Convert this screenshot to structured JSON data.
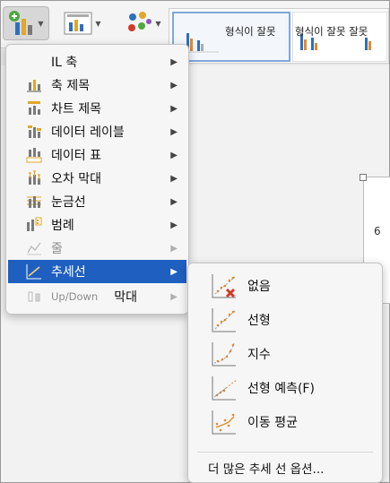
{
  "ribbon": {
    "buttons": [
      {
        "name": "add-chart-element-button",
        "icon": "add-chart-element-icon"
      },
      {
        "name": "quick-layout-button",
        "icon": "quick-layout-icon"
      },
      {
        "name": "change-colors-button",
        "icon": "change-colors-icon"
      }
    ],
    "gallery": {
      "label_1": "형식이 잘못",
      "label_2": "형식이 잘못 잘못"
    }
  },
  "chart": {
    "axis_value": "6"
  },
  "menu": {
    "items": [
      {
        "label": "IL 축",
        "icon": "axes-icon",
        "state": "normal"
      },
      {
        "label": "축 제목",
        "icon": "axis-titles-icon",
        "state": "normal"
      },
      {
        "label": "차트 제목",
        "icon": "chart-title-icon",
        "state": "normal"
      },
      {
        "label": "데이터 레이블",
        "icon": "data-labels-icon",
        "state": "normal"
      },
      {
        "label": "데이터 표",
        "icon": "data-table-icon",
        "state": "normal"
      },
      {
        "label": "오차 막대",
        "icon": "error-bars-icon",
        "state": "normal"
      },
      {
        "label": "눈금선",
        "icon": "gridlines-icon",
        "state": "normal"
      },
      {
        "label": "범례",
        "icon": "legend-icon",
        "state": "normal"
      },
      {
        "label": "줄",
        "icon": "lines-icon",
        "state": "disabled"
      },
      {
        "label": "추세선",
        "icon": "trendline-icon",
        "state": "highlight"
      },
      {
        "label_a": "Up/Down",
        "label_b": "막대",
        "icon": "up-down-bars-icon",
        "state": "disabled"
      }
    ]
  },
  "submenu": {
    "items": [
      {
        "label": "없음",
        "icon": "trendline-none-icon"
      },
      {
        "label": "선형",
        "icon": "trendline-linear-icon"
      },
      {
        "label": "지수",
        "icon": "trendline-exponential-icon"
      },
      {
        "label": "선형 예측(F)",
        "icon": "trendline-linear-forecast-icon"
      },
      {
        "label": "이동 평균",
        "icon": "trendline-moving-average-icon"
      }
    ],
    "more_options": "더 많은 추세 선 옵션..."
  },
  "colors": {
    "highlight": "#1f5fbf",
    "accent_red": "#d23a2a",
    "bar_blue": "#2f6fbd",
    "bar_orange": "#e08a2b"
  }
}
